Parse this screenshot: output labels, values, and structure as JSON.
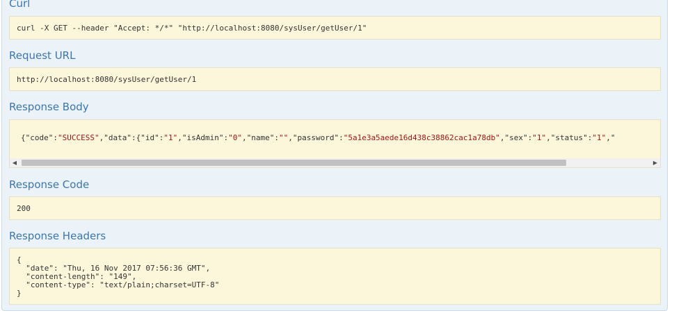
{
  "curl": {
    "heading": "Curl",
    "command": "curl -X GET --header \"Accept: */*\" \"http://localhost:8080/sysUser/getUser/1\""
  },
  "request_url": {
    "heading": "Request URL",
    "value": "http://localhost:8080/sysUser/getUser/1"
  },
  "response_body": {
    "heading": "Response Body",
    "p1": "{",
    "k_code": "\"code\"",
    "v_code": "\"SUCCESS\"",
    "k_data": "\"data\"",
    "k_id": "\"id\"",
    "v_id": "\"1\"",
    "k_isAdmin": "\"isAdmin\"",
    "v_isAdmin": "\"0\"",
    "k_name": "\"name\"",
    "v_name": "\"\"",
    "k_password": "\"password\"",
    "v_password": "\"5a1e3a5aede16d438c38862cac1a78db\"",
    "k_sex": "\"sex\"",
    "v_sex": "\"1\"",
    "k_status": "\"status\"",
    "v_status": "\"1\"",
    "trail": "\""
  },
  "response_code": {
    "heading": "Response Code",
    "value": "200"
  },
  "response_headers": {
    "heading": "Response Headers",
    "value": "{\n  \"date\": \"Thu, 16 Nov 2017 07:56:36 GMT\",\n  \"content-length\": \"149\",\n  \"content-type\": \"text/plain;charset=UTF-8\"\n}"
  },
  "icons": {
    "scroll_left": "◀",
    "scroll_right": "▶"
  },
  "colors": {
    "panel_bg": "#ebf3f9",
    "heading": "#3b76b0",
    "box_bg": "#fcf6db",
    "string_value": "#a31515"
  }
}
